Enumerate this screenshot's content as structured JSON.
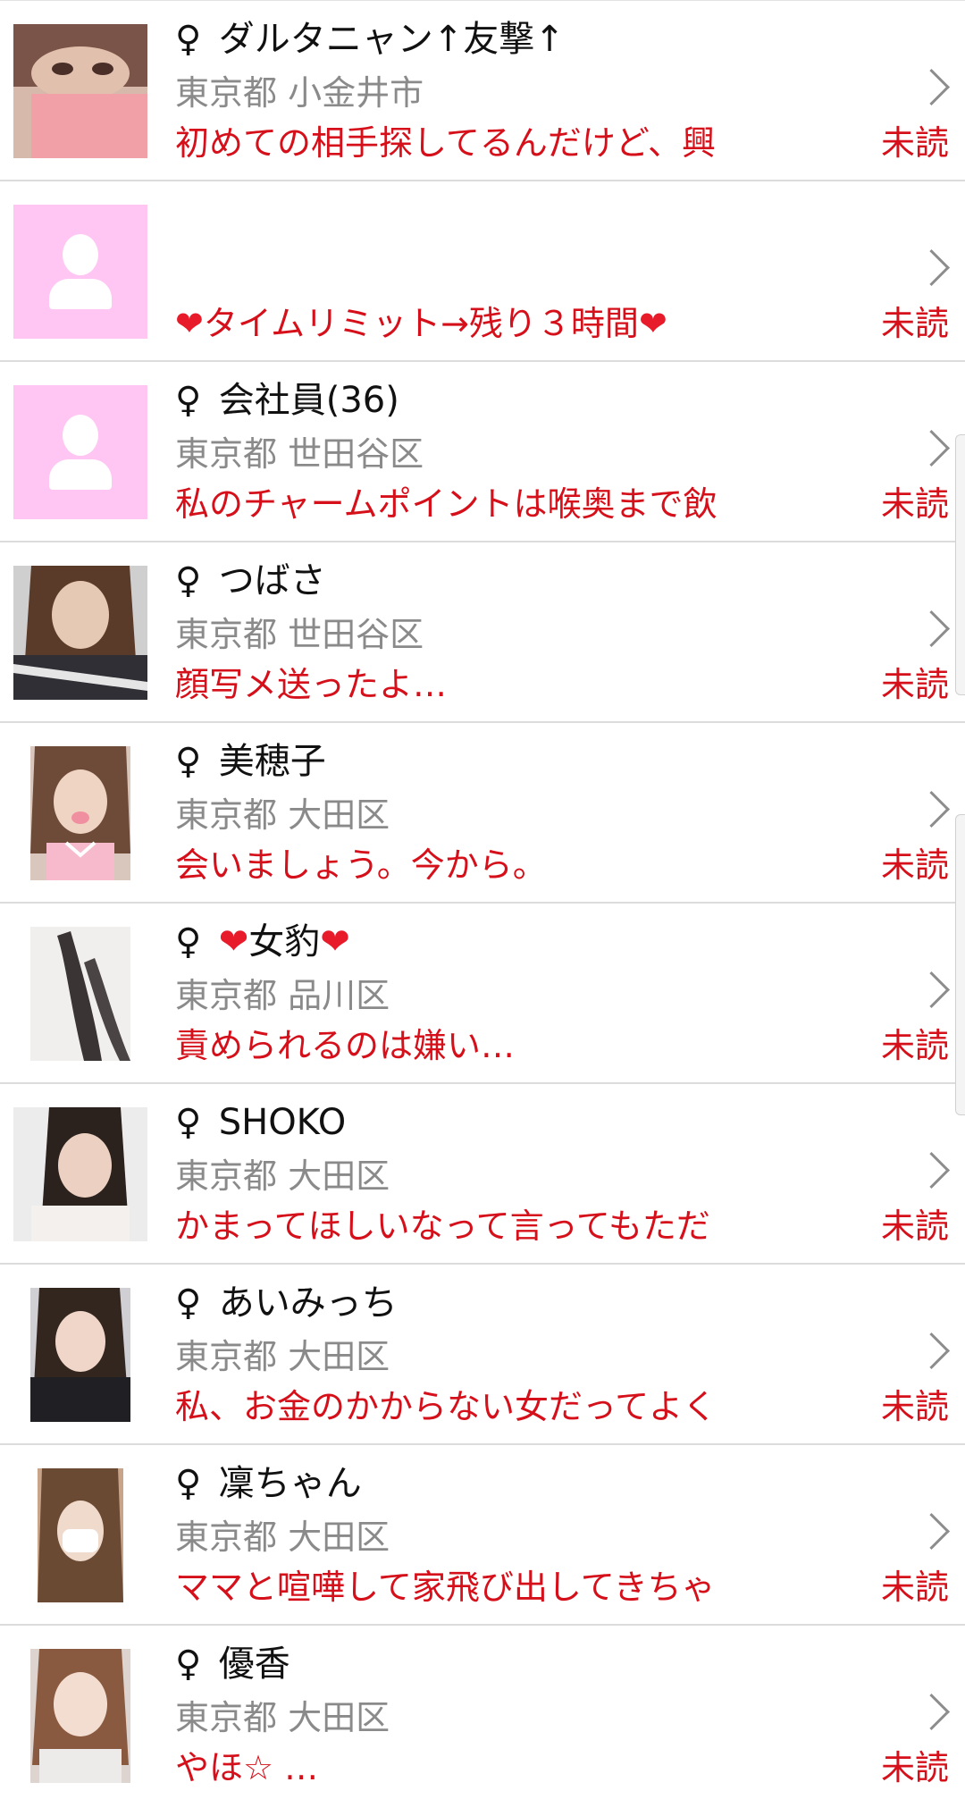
{
  "gender_symbol": "♀",
  "unread_label": "未読",
  "colors": {
    "message": "#d5101a",
    "location": "#8a8a8a",
    "placeholder_avatar": "#ffc6f4",
    "heart": "#e81b2b"
  },
  "icons": {
    "chevron": "chevron-right-icon",
    "placeholder": "user-silhouette-icon",
    "heart": "heart-icon"
  },
  "rows": [
    {
      "name": "ダルタニャン↑友撃↑",
      "location": "東京都 小金井市",
      "message": "初めての相手探してるんだけど、興"
    },
    {
      "name": "",
      "location": "",
      "message_heart_text": "タイムリミット→残り３時間"
    },
    {
      "name": "会社員(36)",
      "location": "東京都 世田谷区",
      "message": "私のチャームポイントは喉奥まで飲"
    },
    {
      "name": "つばさ",
      "location": "東京都 世田谷区",
      "message": "顔写メ送ったよ…"
    },
    {
      "name": "美穂子",
      "location": "東京都 大田区",
      "message": "会いましょう。今から。"
    },
    {
      "name_heart_text": "女豹",
      "location": "東京都 品川区",
      "message": "責められるのは嫌い…"
    },
    {
      "name": "SHOKO",
      "location": "東京都 大田区",
      "message": "かまってほしいなって言ってもただ"
    },
    {
      "name": "あいみっち",
      "location": "東京都 大田区",
      "message": "私、お金のかからない女だってよく"
    },
    {
      "name": "凜ちゃん",
      "location": "東京都 大田区",
      "message": "ママと喧嘩して家飛び出してきちゃ"
    },
    {
      "name": "優香",
      "location": "東京都 大田区",
      "message": "やほ☆ …"
    }
  ]
}
